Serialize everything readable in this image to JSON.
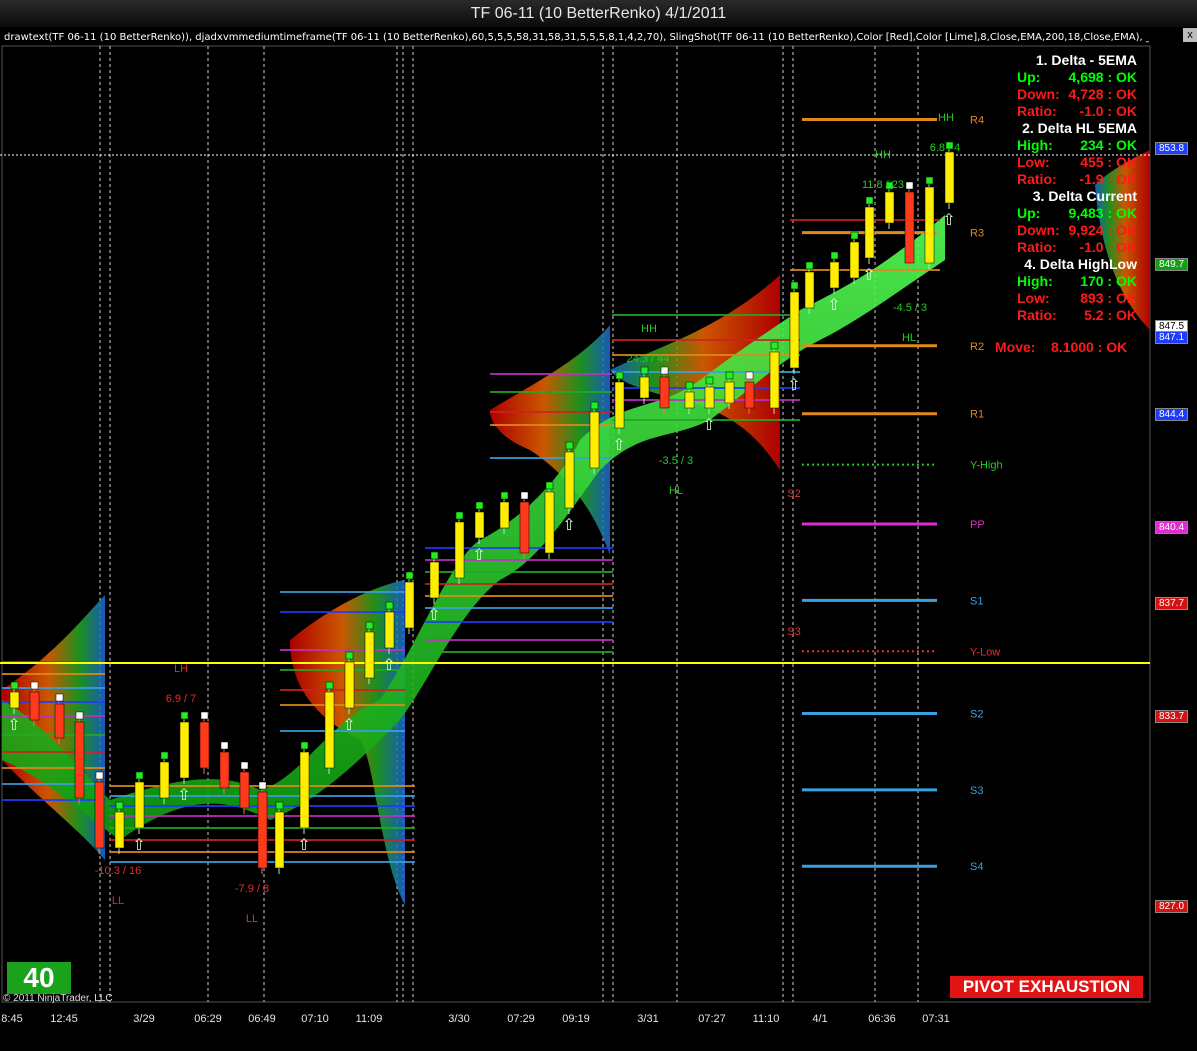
{
  "window": {
    "title": "TF 06-11 (10 BetterRenko)  4/1/2011",
    "close_label": "x"
  },
  "indicator_text": "drawtext(TF 06-11 (10 BetterRenko)), djadxvmmediumtimeframe(TF 06-11 (10 BetterRenko),60,5,5,5,58,31,58,31,5,5,5,8,1,4,2,70), SlingShot(TF 06-11 (10 BetterRenko),Color [Red],Color [Lime],8,Close,EMA,200,18,Close,EMA), _A",
  "colors": {
    "up_bar": "#ffee00",
    "band": "#22dd22",
    "accent_red": "#ff1a1a",
    "accent_green": "#00ff00",
    "horizon_line": "#ffff00"
  },
  "chart_data": {
    "type": "renko-candlestick",
    "title": "TF 06-11 (10 BetterRenko)  4/1/2011",
    "x_tick_labels": [
      "8:45",
      "12:45",
      "3/29",
      "06:29",
      "06:49",
      "07:10",
      "11:09",
      "3/30",
      "07:29",
      "09:19",
      "3/31",
      "07:27",
      "11:10",
      "4/1",
      "06:36",
      "07:31"
    ],
    "ylim": [
      823.6,
      857.4
    ],
    "price_levels": [
      {
        "label": "",
        "value": 853.8,
        "color": "#1e3cff"
      },
      {
        "label": "",
        "value": 849.7,
        "color": "#12a012"
      },
      {
        "label": "",
        "value": 847.5,
        "color": "#ffffff"
      },
      {
        "label": "",
        "value": 847.1,
        "color": "#1e3cff"
      },
      {
        "label": "",
        "value": 844.4,
        "color": "#1e3cff"
      },
      {
        "label": "",
        "value": 840.4,
        "color": "#e02bd2"
      },
      {
        "label": "",
        "value": 837.7,
        "color": "#d01414"
      },
      {
        "label": "",
        "value": 833.7,
        "color": "#d01414"
      },
      {
        "label": "",
        "value": 827.0,
        "color": "#d01414"
      }
    ],
    "pivot_lines": [
      {
        "label": "R4",
        "value": 854.8,
        "color": "#e08a1a"
      },
      {
        "label": "R3",
        "value": 850.8,
        "color": "#e08a1a"
      },
      {
        "label": "R2",
        "value": 846.8,
        "color": "#e08a1a"
      },
      {
        "label": "R1",
        "value": 844.4,
        "color": "#e08a1a"
      },
      {
        "label": "Y-High",
        "value": 842.6,
        "color": "#22cc22"
      },
      {
        "label": "PP",
        "value": 840.5,
        "color": "#e02bd2"
      },
      {
        "label": "S1",
        "value": 837.8,
        "color": "#3aa0e0"
      },
      {
        "label": "Y-Low",
        "value": 836.0,
        "color": "#e03030"
      },
      {
        "label": "S2",
        "value": 833.8,
        "color": "#3aa0e0"
      },
      {
        "label": "S3",
        "value": 831.1,
        "color": "#3aa0e0"
      },
      {
        "label": "S4",
        "value": 828.4,
        "color": "#3aa0e0"
      }
    ],
    "annotations": [
      {
        "text": "HH",
        "x": "07:31",
        "color": "#22cc22"
      },
      {
        "text": "HH",
        "x": "06:36",
        "color": "#22cc22"
      },
      {
        "text": "6.8 / 4",
        "x": "07:31",
        "color": "#22cc22"
      },
      {
        "text": "11.8 / 23",
        "x": "06:36",
        "color": "#22cc22"
      },
      {
        "text": "-4.5 / 3",
        "x": "06:36",
        "color": "#22cc22"
      },
      {
        "text": "HL",
        "x": "06:36",
        "color": "#22cc22"
      },
      {
        "text": "HH",
        "x": "3/31",
        "color": "#22cc22"
      },
      {
        "text": "24.3 / 44",
        "x": "3/31",
        "color": "#22cc22"
      },
      {
        "text": "-3.5 / 3",
        "x": "07:27",
        "color": "#22cc22"
      },
      {
        "text": "HL",
        "x": "07:27",
        "color": "#22cc22"
      },
      {
        "text": "LH",
        "x": "3/29",
        "color": "#e03030"
      },
      {
        "text": "6.9 / 7",
        "x": "3/29",
        "color": "#e03030"
      },
      {
        "text": "-10.3 / 16",
        "x": "12:45",
        "color": "#e03030"
      },
      {
        "text": "LL",
        "x": "12:45",
        "color": "#e03030"
      },
      {
        "text": "-7.9 / 8",
        "x": "06:49",
        "color": "#e03030"
      },
      {
        "text": "LL",
        "x": "06:49",
        "color": "#e03030"
      },
      {
        "text": "S2",
        "x": "11:10",
        "color": "#e03030"
      },
      {
        "text": "S3",
        "x": "11:10",
        "color": "#e03030"
      }
    ]
  },
  "panel": {
    "sections": [
      {
        "header": "1. Delta - 5EMA",
        "rows": [
          {
            "label": "Up:",
            "value": "4,698   : OK",
            "color": "#00ff00"
          },
          {
            "label": "Down:",
            "value": "4,728   : OK",
            "color": "#ff1a1a"
          },
          {
            "label": "Ratio:",
            "value": "-1.0   : OK",
            "color": "#ff1a1a"
          }
        ]
      },
      {
        "header": "2. Delta HL 5EMA",
        "rows": [
          {
            "label": "High:",
            "value": "234   : OK",
            "color": "#00ff00"
          },
          {
            "label": "Low:",
            "value": "455   : OK",
            "color": "#ff1a1a"
          },
          {
            "label": "Ratio:",
            "value": "-1.9   : OK",
            "color": "#ff1a1a"
          }
        ]
      },
      {
        "header": "3. Delta Current",
        "rows": [
          {
            "label": "Up:",
            "value": "9,483   : OK",
            "color": "#00ff00"
          },
          {
            "label": "Down:",
            "value": "9,924   : OK",
            "color": "#ff1a1a"
          },
          {
            "label": "Ratio:",
            "value": "-1.0   : OK",
            "color": "#ff1a1a"
          }
        ]
      },
      {
        "header": "4. Delta HighLow",
        "rows": [
          {
            "label": "High:",
            "value": "170   : OK",
            "color": "#00ff00"
          },
          {
            "label": "Low:",
            "value": "893   : OK",
            "color": "#ff1a1a"
          },
          {
            "label": "Ratio:",
            "value": "5.2   : OK",
            "color": "#ff1a1a"
          }
        ]
      }
    ],
    "move": {
      "label": "Move:",
      "value": "8.1000   : OK"
    }
  },
  "bar_count": "40",
  "copyright": "© 2011 NinjaTrader, LLC",
  "pivot_banner": "PIVOT EXHAUSTION"
}
